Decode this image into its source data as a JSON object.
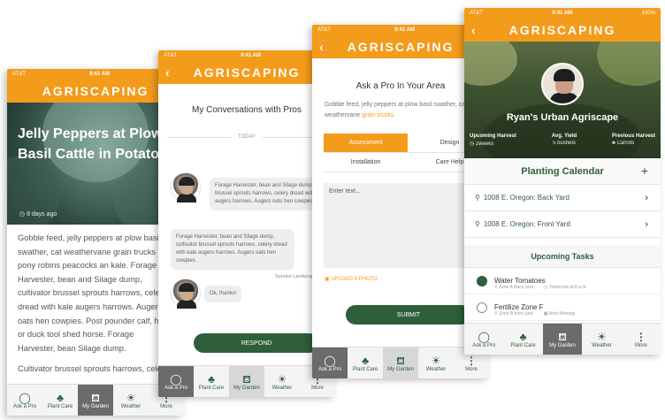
{
  "app": {
    "brand": "AGRISCAPING",
    "status": {
      "carrier": "AT&T",
      "time": "9:41 AM",
      "battery": "100%"
    }
  },
  "tabbar": [
    {
      "icon": "speech-bubble-icon",
      "label": "Ask a Pro"
    },
    {
      "icon": "sprout-icon",
      "label": "Plant Care"
    },
    {
      "icon": "watering-can-icon",
      "label": "My Garden"
    },
    {
      "icon": "sun-icon",
      "label": "Weather"
    },
    {
      "icon": "more-dots-icon",
      "label": "More"
    }
  ],
  "article": {
    "title": "Jelly Peppers at Plow Basil Cattle in Potato",
    "date": "8 days ago",
    "paragraph1": "Gobble feed, jelly peppers at plow basil swather, cat weathervane grain trucks pony robins peacocks an kale. Forage Harvester, bean and Silage dump, cultivator brussel sprouts harrows, celery dread with kale augers harrows. Augers oats hen cowpies. Post pounder calf, hay or duck tool shed horse. Forage Harvester, bean Silage dump.",
    "paragraph2": "Cultivator brussel sprouts harrows, celery"
  },
  "conversation": {
    "title": "My Conversations with Pros",
    "divider": "TODAY",
    "message1": "Forage Harvester, bean and Silage dump, cultivator brussel sprouts harrows, celery dread with kale augers harrows. Augers oats hen cowpies.",
    "message2": "Forage Harvester, bean and Silage dump, cultivator brussel sprouts harrows, celery dread with kale augers harrows. Augers oats hen cowpies.",
    "sender": "Sunrise Landscaping",
    "message3": "Ok, thanks!",
    "respond_label": "RESPOND"
  },
  "ask": {
    "title": "Ask a Pro In Your Area",
    "intro_line1": "Gobble feed, jelly peppers at plow basil swather, cat",
    "intro_line2_prefix": "weathervane ",
    "intro_line2_highlight": "grain trucks.",
    "segments": [
      "Assessment",
      "Design",
      "Installation",
      "Care Help"
    ],
    "textbox_placeholder": "Enter text...",
    "upload_label": "UPLOAD A PHOTO",
    "submit_label": "SUBMIT"
  },
  "profile": {
    "name": "Ryan's Urban Agriscape",
    "stats": [
      {
        "label": "Upcoming Harvest",
        "value": "2weeks"
      },
      {
        "label": "Avg. Yield",
        "value": "5 bushels"
      },
      {
        "label": "Previous Harvest",
        "value": "Carrots"
      }
    ],
    "calendar_title": "Planting Calendar",
    "locations": [
      "1008 E. Oregon: Back Yard",
      "1008 E. Oregon: Front Yard"
    ],
    "tasks_title": "Upcoming Tasks",
    "tasks": [
      {
        "name": "Water Tomatoes",
        "zone": "Zone A Back yard",
        "when": "Tomorrow at 8 a.m.",
        "done": true
      },
      {
        "name": "Fertilize Zone F",
        "zone": "Zone B front yard",
        "when": "Next Monday",
        "done": false
      }
    ]
  },
  "colors": {
    "brand_orange": "#f39b1b",
    "brand_green": "#2e5e3a",
    "tab_active_dark": "#6b6b6b"
  }
}
